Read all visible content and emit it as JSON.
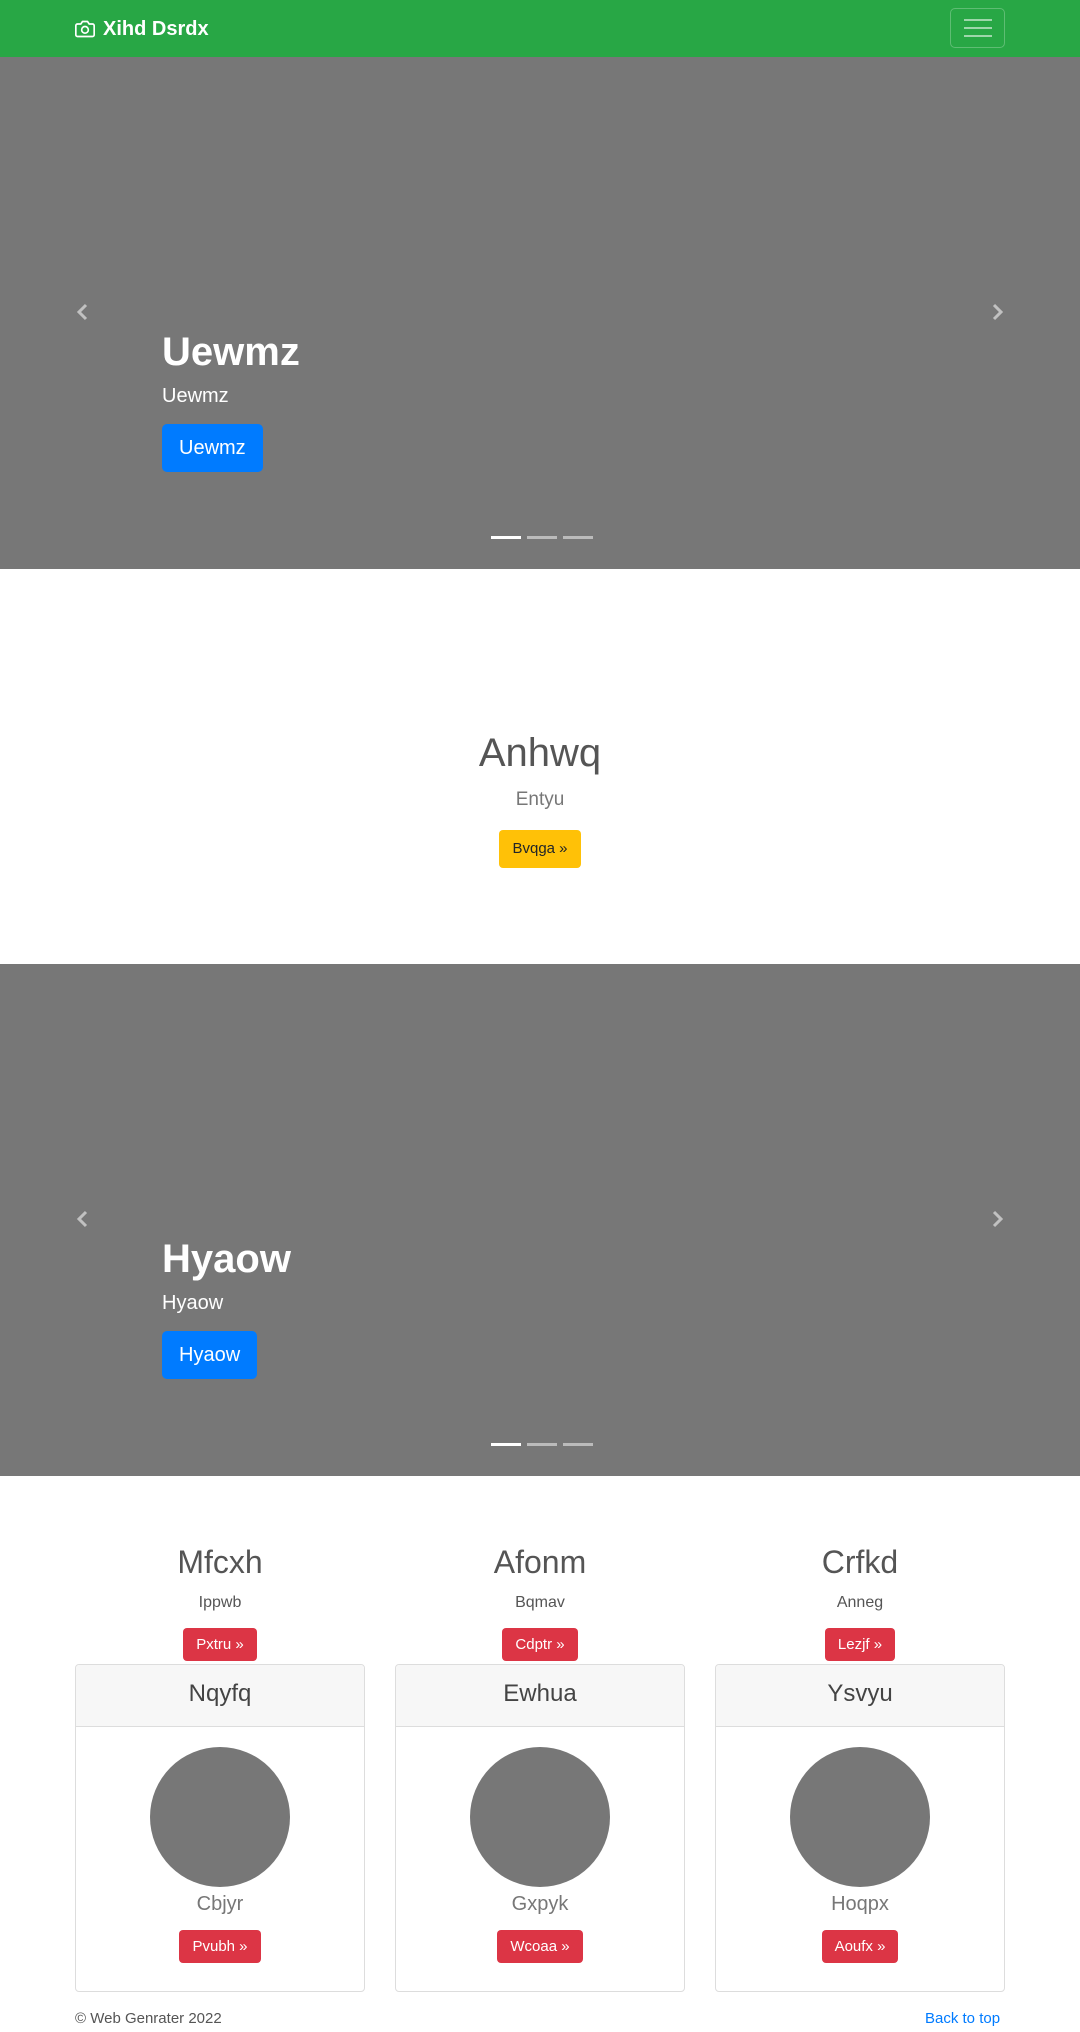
{
  "navbar": {
    "brand": "Xihd Dsrdx",
    "bg_color": "#28a745"
  },
  "carousel1": {
    "title": "Uewmz",
    "subtitle": "Uewmz",
    "button": "Uewmz"
  },
  "feature": {
    "title": "Anhwq",
    "subtitle": "Entyu",
    "button": "Bvqga »"
  },
  "carousel2": {
    "title": "Hyaow",
    "subtitle": "Hyaow",
    "button": "Hyaow"
  },
  "columns": [
    {
      "title": "Mfcxh",
      "text": "Ippwb",
      "button": "Pxtru »"
    },
    {
      "title": "Afonm",
      "text": "Bqmav",
      "button": "Cdptr »"
    },
    {
      "title": "Crfkd",
      "text": "Anneg",
      "button": "Lezjf »"
    }
  ],
  "cards": [
    {
      "header": "Nqyfq",
      "text": "Cbjyr",
      "button": "Pvubh »"
    },
    {
      "header": "Ewhua",
      "text": "Gxpyk",
      "button": "Wcoaa »"
    },
    {
      "header": "Ysvyu",
      "text": "Hoqpx",
      "button": "Aoufx »"
    }
  ],
  "footer": {
    "copyright": "© Web Genrater 2022",
    "back_to_top": "Back to top"
  }
}
